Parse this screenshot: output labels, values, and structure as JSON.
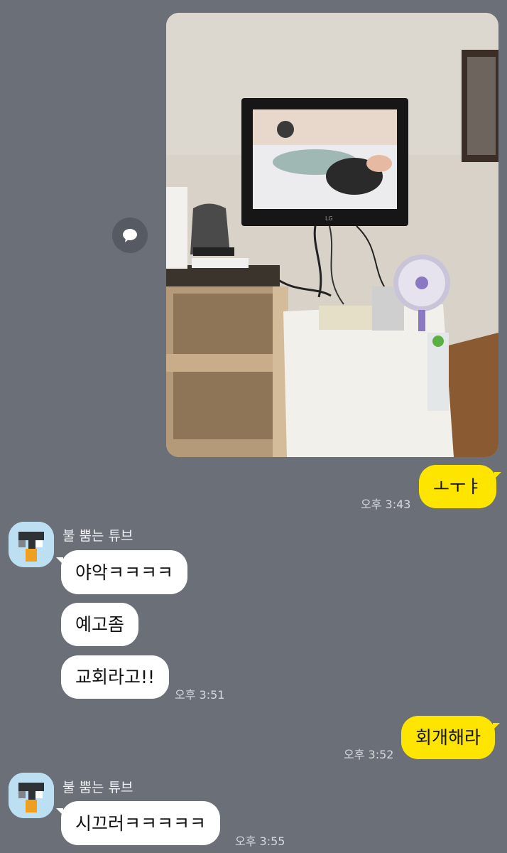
{
  "messages": {
    "me1": {
      "text": "ㅗㅜㅑ",
      "time": "오후 3:43"
    },
    "group1": {
      "sender": "불 뿜는 튜브",
      "msgs": [
        "야악ㅋㅋㅋㅋ",
        "예고좀",
        "교회라고!!"
      ],
      "time": "오후 3:51"
    },
    "me2": {
      "text": "회개해라",
      "time": "오후 3:52"
    },
    "group2": {
      "sender": "불 뿜는 튜브",
      "msgs": [
        "시끄러ㅋㅋㅋㅋㅋ"
      ],
      "time": "오후 3:55"
    }
  },
  "photo": {
    "tv_brand": "LG"
  },
  "icons": {
    "share": "speech-bubble-icon",
    "avatar": "tube-avatar-icon"
  },
  "colors": {
    "background": "#6b6f78",
    "my_bubble": "#fee500",
    "their_bubble": "#ffffff"
  }
}
